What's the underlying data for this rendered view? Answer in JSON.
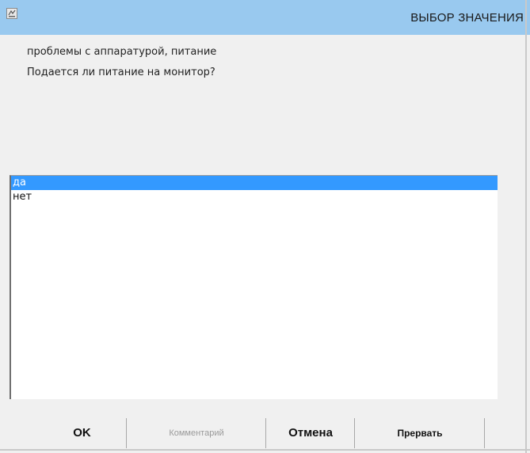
{
  "window": {
    "title": "ВЫБОР ЗНАЧЕНИЯ",
    "icon": "app-icon"
  },
  "prompt": {
    "line1": "проблемы с аппаратурой, питание",
    "line2": "Подается ли питание на монитор?"
  },
  "options": {
    "items": [
      {
        "label": "да",
        "selected": true
      },
      {
        "label": "нет",
        "selected": false
      }
    ]
  },
  "buttons": {
    "ok": "OK",
    "comment": "Комментарий",
    "cancel": "Отмена",
    "abort": "Прервать"
  },
  "colors": {
    "titlebar": "#99c9ef",
    "selection": "#3399ff",
    "window_bg": "#f0f0f0",
    "disabled_text": "#9a9a9a"
  }
}
